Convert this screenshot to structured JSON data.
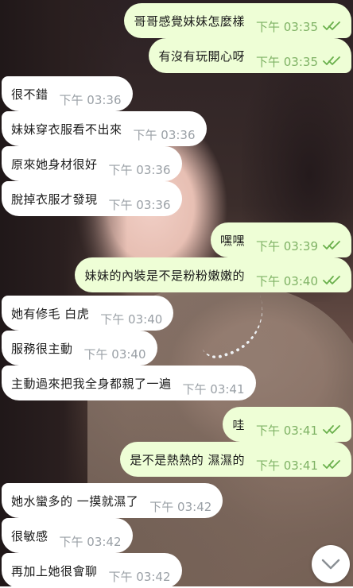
{
  "messages": [
    {
      "side": "out",
      "text": "哥哥感覺妹妹怎麼樣",
      "time": "下午 03:35",
      "read": true
    },
    {
      "side": "out",
      "text": "有沒有玩開心呀",
      "time": "下午 03:35",
      "read": true
    },
    {
      "side": "in",
      "text": "很不錯",
      "time": "下午 03:36"
    },
    {
      "side": "in",
      "text": "妹妹穿衣服看不出來",
      "time": "下午 03:36"
    },
    {
      "side": "in",
      "text": "原來她身材很好",
      "time": "下午 03:36"
    },
    {
      "side": "in",
      "text": "脫掉衣服才發現",
      "time": "下午 03:36"
    },
    {
      "side": "out",
      "text": "嘿嘿",
      "time": "下午 03:39",
      "read": true
    },
    {
      "side": "out",
      "text": "妹妹的內裝是不是粉粉嫩嫩的",
      "time": "下午 03:40",
      "read": true
    },
    {
      "side": "in",
      "text": "她有修毛 白虎",
      "time": "下午 03:40"
    },
    {
      "side": "in",
      "text": "服務很主動",
      "time": "下午 03:40"
    },
    {
      "side": "in",
      "text": "主動過來把我全身都親了一遍",
      "time": "下午 03:41"
    },
    {
      "side": "out",
      "text": "哇",
      "time": "下午 03:41",
      "read": true
    },
    {
      "side": "out",
      "text": "是不是熱熱的 濕濕的",
      "time": "下午 03:41",
      "read": true
    },
    {
      "side": "in",
      "text": "她水蠻多的 一摸就濕了",
      "time": "下午 03:42"
    },
    {
      "side": "in",
      "text": "很敏感",
      "time": "下午 03:42"
    },
    {
      "side": "in",
      "text": "再加上她很會聊",
      "time": "下午 03:42"
    }
  ],
  "scroll_down": {
    "icon": "chevron-down-icon"
  },
  "colors": {
    "outgoing_bubble": "#eefed6",
    "incoming_bubble": "#ffffff",
    "read_tick": "#6ab04c",
    "time_gray": "#9aa0a6"
  }
}
